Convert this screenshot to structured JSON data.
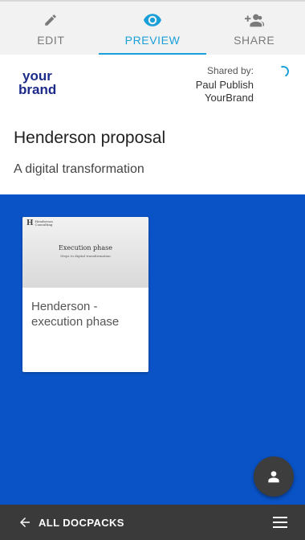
{
  "tabs": [
    {
      "label": "EDIT",
      "icon": "pencil-icon"
    },
    {
      "label": "PREVIEW",
      "icon": "eye-icon",
      "active": true
    },
    {
      "label": "SHARE",
      "icon": "person-add-icon"
    }
  ],
  "brand": {
    "line1": "your",
    "line2": "brand",
    "color": "#1c2a8a"
  },
  "shared": {
    "label": "Shared by:",
    "name": "Paul Publish",
    "company": "YourBrand"
  },
  "doc": {
    "title": "Henderson proposal",
    "subtitle": "A digital transformation"
  },
  "cards": [
    {
      "thumb_brand": "Henderson Consulting",
      "thumb_title": "Execution phase",
      "thumb_subtitle": "Steps to digital transformation",
      "name": "Henderson - execution phase"
    }
  ],
  "bottom": {
    "back_label": "ALL DOCPACKS"
  },
  "colors": {
    "accent": "#1aa0d8",
    "background": "#0a53c7",
    "bar": "#3a3a3a"
  }
}
